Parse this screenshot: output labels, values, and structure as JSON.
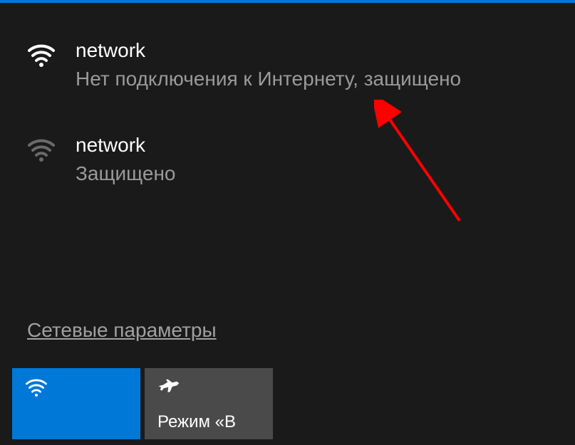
{
  "networks": [
    {
      "name": "network",
      "status": "Нет подключения к Интернету, защищено",
      "connected": true
    },
    {
      "name": "network",
      "status": "Защищено",
      "connected": false
    }
  ],
  "settingsLink": "Сетевые параметры",
  "tiles": {
    "wifi": {
      "active": true
    },
    "airplane": {
      "label": "Режим «В"
    }
  },
  "colors": {
    "accent": "#0078d7",
    "background": "#1a1a1a",
    "tileInactive": "#4a4a4a",
    "textPrimary": "#ffffff",
    "textSecondary": "#9a9a9a"
  }
}
